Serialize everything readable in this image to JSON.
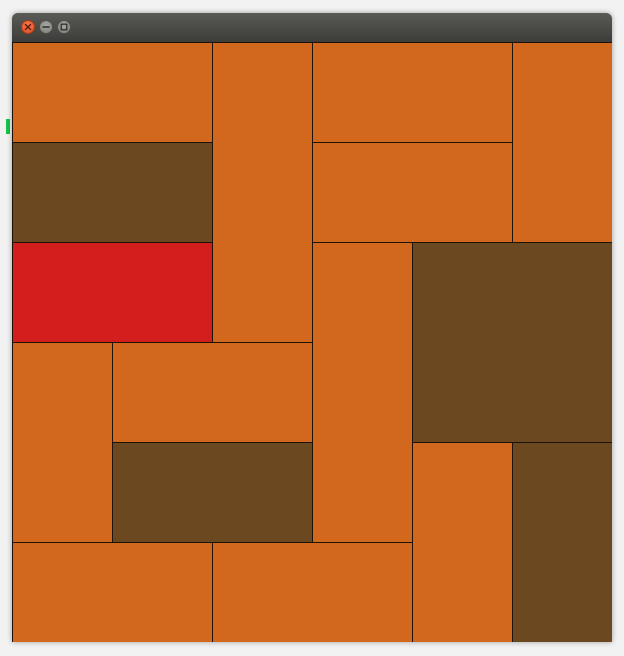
{
  "colors": {
    "orange_block": "#d2681e",
    "brown_block": "#6b4820",
    "red_block": "#d41e1e",
    "marker": "#17c34a"
  },
  "window": {
    "controls": [
      {
        "name": "close-icon"
      },
      {
        "name": "minimize-icon"
      },
      {
        "name": "maximize-icon"
      }
    ]
  },
  "board": {
    "grid": {
      "cols": 6,
      "rows": 6
    },
    "blocks": [
      {
        "id": "a",
        "color": "orange",
        "col": 0,
        "row": 0,
        "w": 2,
        "h": 1
      },
      {
        "id": "b",
        "color": "orange",
        "col": 2,
        "row": 0,
        "w": 1,
        "h": 3
      },
      {
        "id": "c",
        "color": "orange",
        "col": 3,
        "row": 0,
        "w": 2,
        "h": 1
      },
      {
        "id": "d",
        "color": "orange",
        "col": 5,
        "row": 0,
        "w": 1,
        "h": 2
      },
      {
        "id": "e",
        "color": "brown",
        "col": 0,
        "row": 1,
        "w": 2,
        "h": 1
      },
      {
        "id": "f",
        "color": "orange",
        "col": 3,
        "row": 1,
        "w": 2,
        "h": 1
      },
      {
        "id": "target",
        "color": "red",
        "col": 0,
        "row": 2,
        "w": 2,
        "h": 1
      },
      {
        "id": "g",
        "color": "orange",
        "col": 3,
        "row": 2,
        "w": 1,
        "h": 3
      },
      {
        "id": "h",
        "color": "brown",
        "col": 4,
        "row": 2,
        "w": 2,
        "h": 2
      },
      {
        "id": "i",
        "color": "orange",
        "col": 0,
        "row": 3,
        "w": 1,
        "h": 2
      },
      {
        "id": "j",
        "color": "orange",
        "col": 1,
        "row": 3,
        "w": 2,
        "h": 1
      },
      {
        "id": "k",
        "color": "brown",
        "col": 1,
        "row": 4,
        "w": 2,
        "h": 1
      },
      {
        "id": "l",
        "color": "orange",
        "col": 4,
        "row": 4,
        "w": 1,
        "h": 2
      },
      {
        "id": "m",
        "color": "brown",
        "col": 5,
        "row": 4,
        "w": 1,
        "h": 2
      },
      {
        "id": "n",
        "color": "orange",
        "col": 0,
        "row": 5,
        "w": 2,
        "h": 1
      },
      {
        "id": "o",
        "color": "orange",
        "col": 2,
        "row": 5,
        "w": 2,
        "h": 1
      }
    ]
  }
}
